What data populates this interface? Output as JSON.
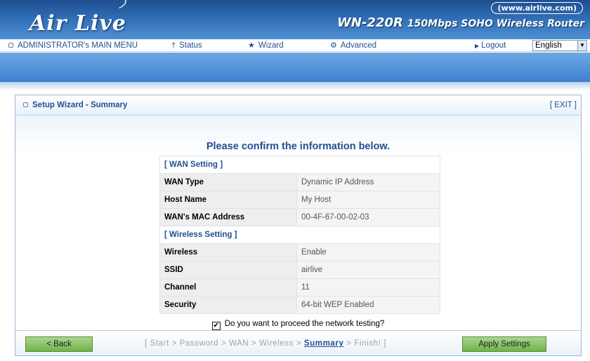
{
  "header": {
    "logo_text": "Air Live",
    "site_url": "(www.airlive.com)",
    "model": "WN-220R",
    "model_desc": "150Mbps SOHO Wireless Router"
  },
  "nav": {
    "admin_menu": "ADMINISTRATOR's MAIN MENU",
    "status": "Status",
    "wizard": "Wizard",
    "advanced": "Advanced",
    "logout": "Logout",
    "language": "English"
  },
  "panel": {
    "title": "Setup Wizard - Summary",
    "exit": "[ EXIT ]",
    "confirm_heading": "Please confirm the information below."
  },
  "summary": {
    "wan_section": "[ WAN Setting ]",
    "wan_rows": [
      {
        "label": "WAN Type",
        "value": "Dynamic IP Address"
      },
      {
        "label": "Host Name",
        "value": "My Host"
      },
      {
        "label": "WAN's MAC Address",
        "value": "00-4F-67-00-02-03"
      }
    ],
    "wireless_section": "[ Wireless Setting ]",
    "wireless_rows": [
      {
        "label": "Wireless",
        "value": "Enable"
      },
      {
        "label": "SSID",
        "value": "airlive"
      },
      {
        "label": "Channel",
        "value": "11"
      },
      {
        "label": "Security",
        "value": "64-bit WEP Enabled"
      }
    ]
  },
  "proceed": {
    "checked": true,
    "label": "Do you want to proceed the network testing?"
  },
  "footer": {
    "back_label": "< Back",
    "apply_label": "Apply Settings",
    "steps_prefix": "[ Start > Password > WAN > Wireless > ",
    "steps_current": "Summary",
    "steps_suffix": " > Finish! ]"
  },
  "colors": {
    "brand_blue": "#1f4f93",
    "header_blue": "#2f6db5",
    "button_green": "#6fb34a"
  },
  "icons": {
    "status": "status-figure-icon",
    "wizard": "wizard-icon",
    "advanced": "advanced-gear-icon",
    "checkbox": "checkmark-icon"
  }
}
